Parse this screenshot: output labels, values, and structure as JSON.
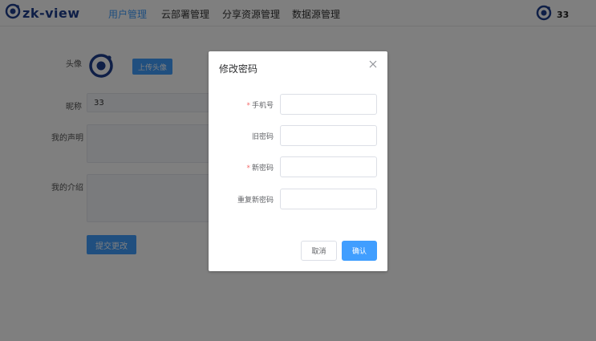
{
  "app": {
    "logo_text": "zk-view"
  },
  "nav": {
    "items": [
      {
        "label": "用户管理",
        "active": true
      },
      {
        "label": "云部署管理",
        "active": false
      },
      {
        "label": "分享资源管理",
        "active": false
      },
      {
        "label": "数据源管理",
        "active": false
      }
    ]
  },
  "user": {
    "name": "33"
  },
  "profile": {
    "avatar_label": "头像",
    "upload_button": "上传头像",
    "nickname_label": "昵称",
    "nickname_value": "33",
    "statement_label": "我的声明",
    "intro_label": "我的介绍",
    "submit_button": "提交更改"
  },
  "dialog": {
    "title": "修改密码",
    "fields": [
      {
        "label": "手机号",
        "required": true,
        "value": ""
      },
      {
        "label": "旧密码",
        "required": false,
        "value": ""
      },
      {
        "label": "新密码",
        "required": true,
        "value": ""
      },
      {
        "label": "重复新密码",
        "required": false,
        "value": ""
      }
    ],
    "cancel_label": "取消",
    "confirm_label": "确认"
  },
  "colors": {
    "primary": "#409eff",
    "logo": "#1f3f8f",
    "required": "#f56c6c"
  },
  "icons": {
    "logo": "orbit-logo-icon",
    "avatar": "orbit-avatar-icon",
    "close": "close-icon"
  }
}
